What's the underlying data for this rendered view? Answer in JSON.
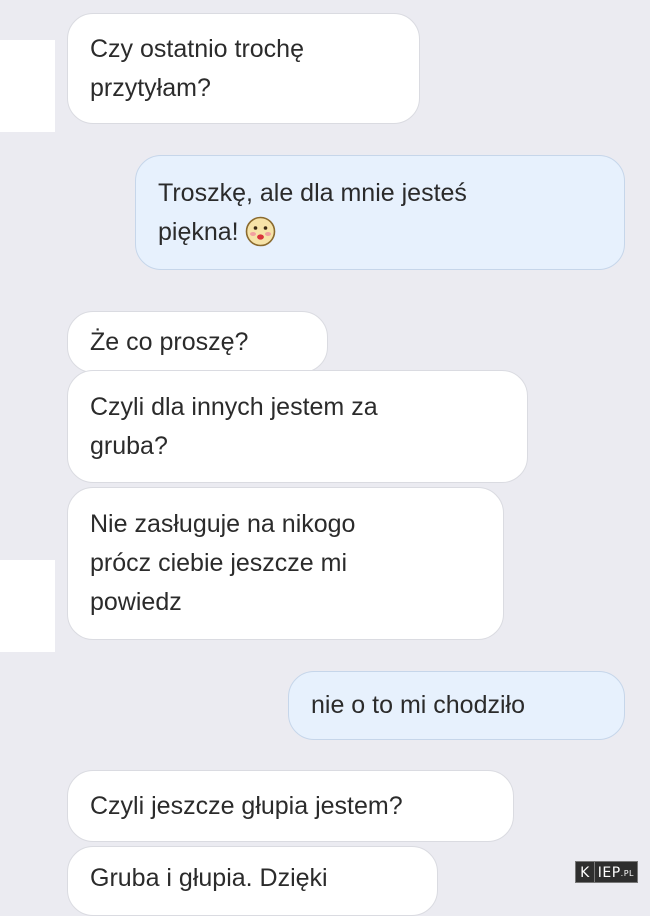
{
  "conversation": {
    "messages": [
      {
        "side": "in",
        "text": "Czy ostatnio trochę\nprzytyłam?"
      },
      {
        "side": "out",
        "text": "Troszkę, ale dla mnie jesteś\npiękna!",
        "emoji": "blushing-face-icon"
      },
      {
        "side": "in",
        "text": "Że co proszę?"
      },
      {
        "side": "in",
        "text": "Czyli dla innych jestem za\ngruba?"
      },
      {
        "side": "in",
        "text": "Nie zasługuje na nikogo\nprócz ciebie jeszcze mi\npowiedz"
      },
      {
        "side": "out",
        "text": "nie o to mi chodziło"
      },
      {
        "side": "in",
        "text": "Czyli jeszcze głupia jestem?"
      },
      {
        "side": "in",
        "text": "Gruba i głupia. Dzięki"
      }
    ]
  },
  "watermark": {
    "first": "K",
    "rest": "IEP",
    "suffix": ".PL"
  },
  "colors": {
    "background": "#ebebf1",
    "incoming_bubble": "#ffffff",
    "outgoing_bubble": "#e7f1fd",
    "text": "#2b2b2b"
  }
}
